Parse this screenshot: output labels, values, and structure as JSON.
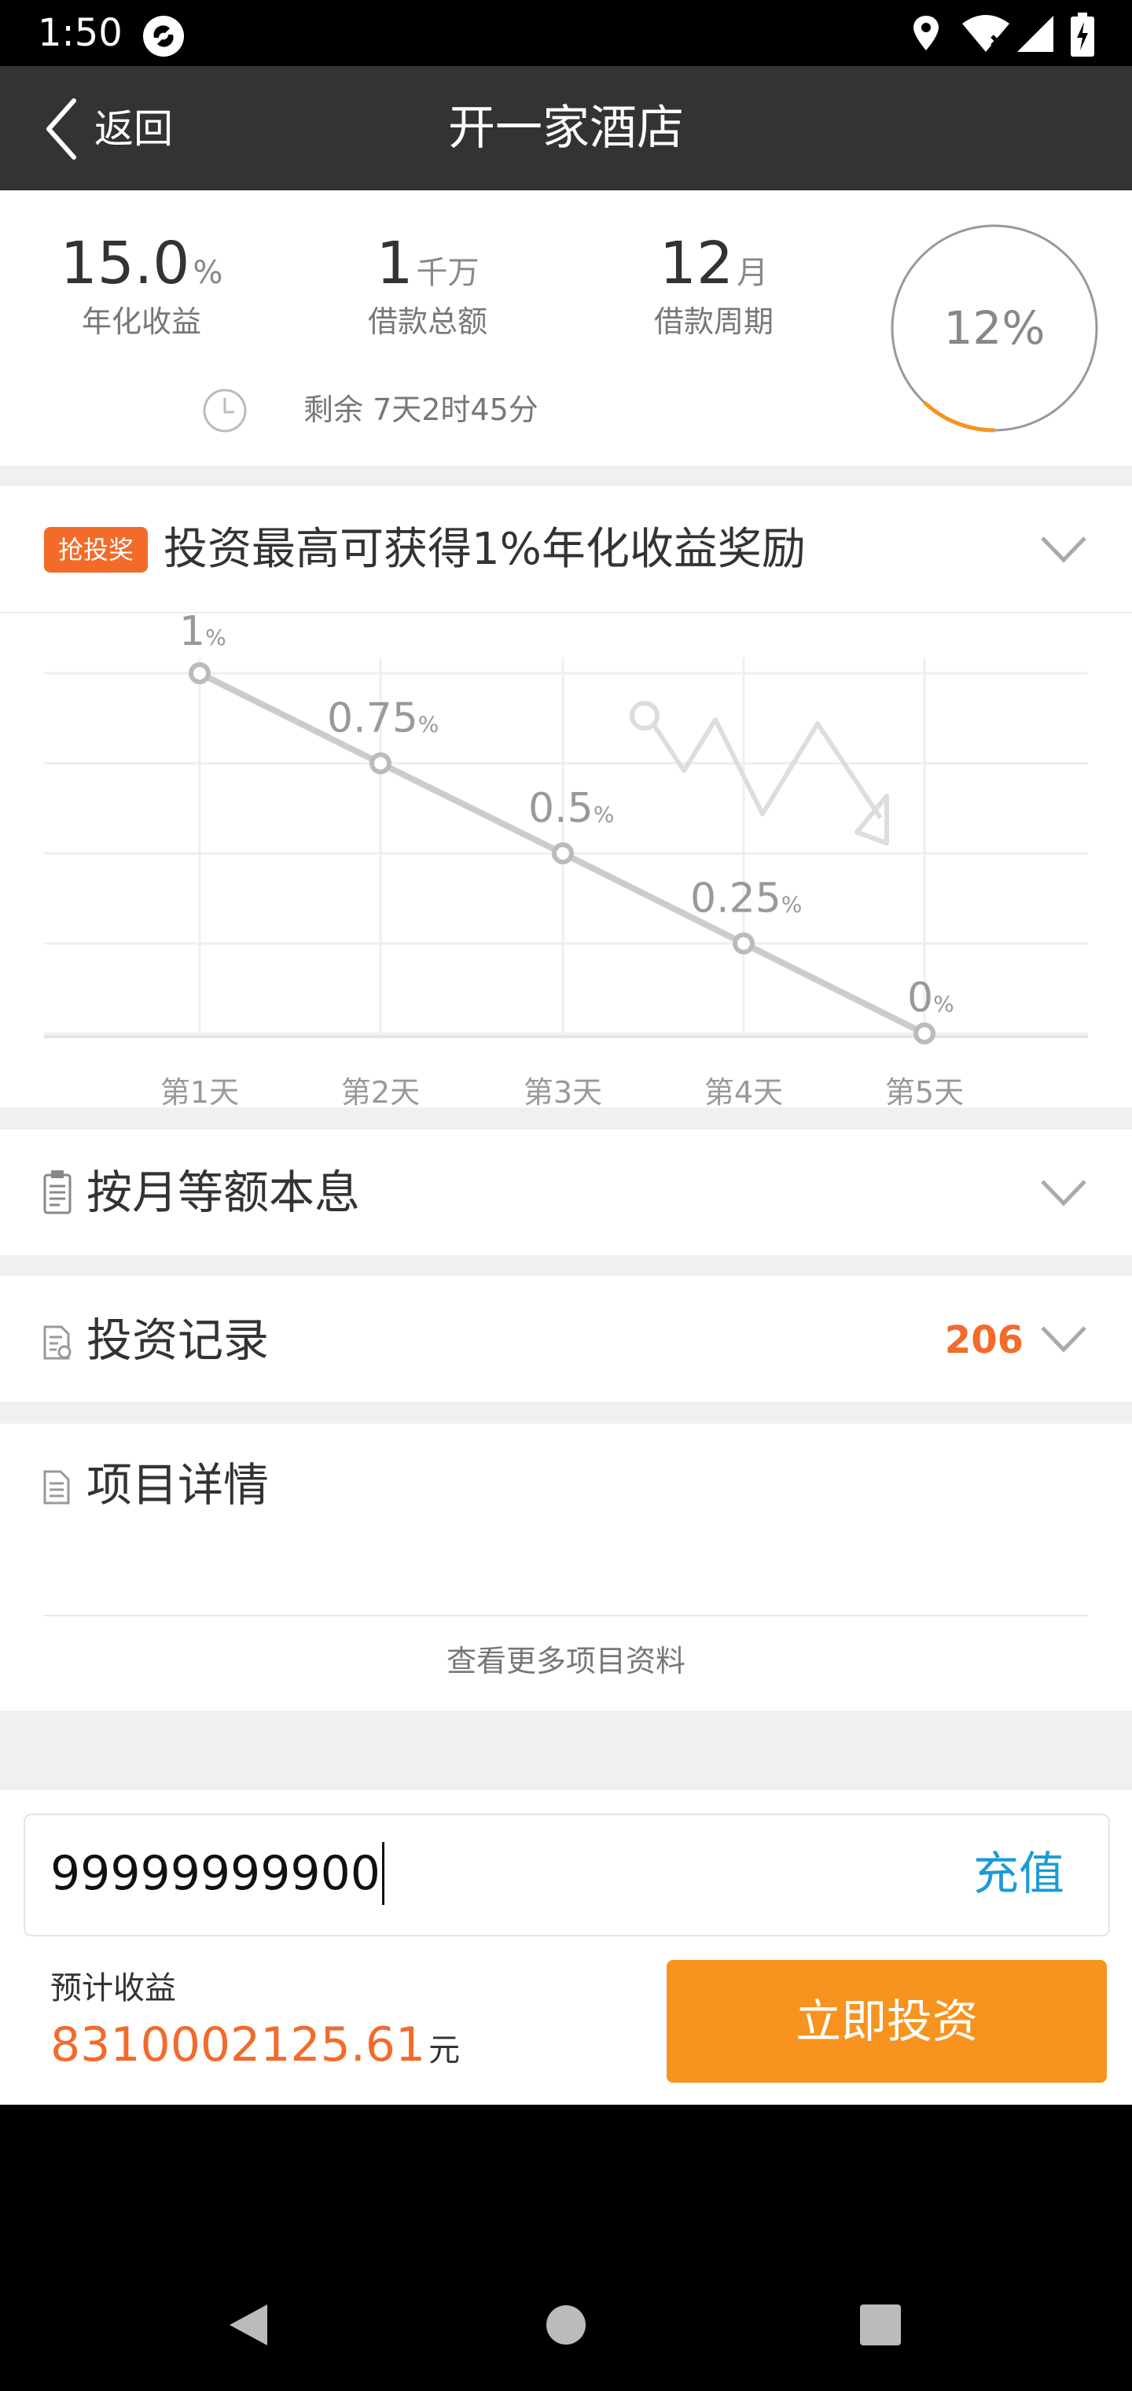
{
  "status_bar": {
    "time": "1:50"
  },
  "nav": {
    "back_label": "返回",
    "title": "开一家酒店"
  },
  "summary": {
    "rate_value": "15.0",
    "rate_unit": "%",
    "rate_label": "年化收益",
    "amount_value": "1",
    "amount_unit": "千万",
    "amount_label": "借款总额",
    "term_value": "12",
    "term_unit": "月",
    "term_label": "借款周期",
    "remaining": "剩余 7天2时45分",
    "progress_text": "12%",
    "progress_fraction": 0.12,
    "accent_color": "#f7931e"
  },
  "reward": {
    "badge": "抢投奖",
    "heading": "投资最高可获得1%年化收益奖励"
  },
  "chart_data": {
    "type": "line",
    "categories": [
      "第1天",
      "第2天",
      "第3天",
      "第4天",
      "第5天"
    ],
    "values": [
      1,
      0.75,
      0.5,
      0.25,
      0
    ],
    "value_labels": [
      "1",
      "0.75",
      "0.5",
      "0.25",
      "0"
    ],
    "value_unit": "%",
    "ylim": [
      0,
      1
    ],
    "grid": true,
    "line_color": "#cccccc"
  },
  "sections": {
    "repay_label": "按月等额本息",
    "records_label": "投资记录",
    "records_count": "206",
    "details_label": "项目详情",
    "more_link": "查看更多项目资料"
  },
  "invest": {
    "amount": "99999999900",
    "recharge_label": "充值",
    "estimate_label": "预计收益",
    "estimate_value": "8310002125.61",
    "estimate_unit": "元",
    "invest_button": "立即投资"
  }
}
